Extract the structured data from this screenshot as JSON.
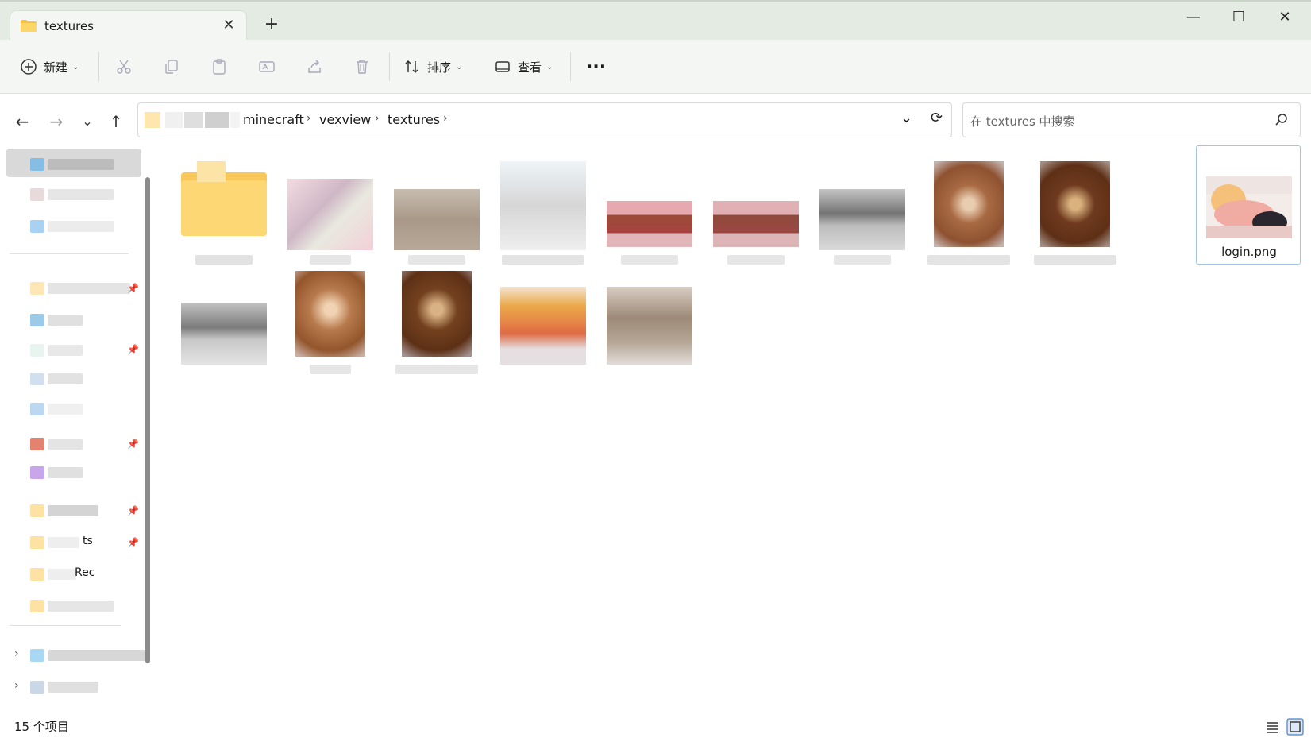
{
  "window": {
    "tab_title": "textures",
    "tab_close": "✕",
    "new_tab": "+",
    "minimize": "—",
    "maximize": "☐",
    "close": "✕"
  },
  "toolbar": {
    "new_label": "新建",
    "sort_label": "排序",
    "view_label": "查看",
    "more_label": "···"
  },
  "nav": {
    "back": "←",
    "forward": "→",
    "recent": "⌄",
    "up": "↑"
  },
  "address": {
    "crumbs": [
      "minecraft",
      "vexview",
      "textures"
    ],
    "separator": "›",
    "dropdown": "⌄",
    "refresh": "⟳"
  },
  "search": {
    "placeholder": "在 textures 中搜索"
  },
  "sidebar": {
    "partial_labels": [
      "Rec",
      "ts"
    ]
  },
  "files": [
    {
      "name": "",
      "kind": "folder"
    },
    {
      "name": "",
      "kind": "image"
    },
    {
      "name": "",
      "kind": "image"
    },
    {
      "name": "",
      "kind": "image"
    },
    {
      "name": "",
      "kind": "image"
    },
    {
      "name": "",
      "kind": "image"
    },
    {
      "name": "",
      "kind": "image"
    },
    {
      "name": "",
      "kind": "image"
    },
    {
      "name": "",
      "kind": "image"
    },
    {
      "name": "login.png",
      "kind": "image",
      "selected": true
    },
    {
      "name": "",
      "kind": "image"
    },
    {
      "name": "",
      "kind": "image"
    },
    {
      "name": "",
      "kind": "image"
    },
    {
      "name": "",
      "kind": "image"
    },
    {
      "name": "",
      "kind": "image"
    }
  ],
  "status": {
    "item_count": "15 个项目"
  },
  "colors": {
    "titlebar_bg": "#e3ebe2",
    "toolbar_bg": "#f3f6f2",
    "selection_border": "#9ec6e8",
    "folder_yellow": "#f6c24a"
  }
}
